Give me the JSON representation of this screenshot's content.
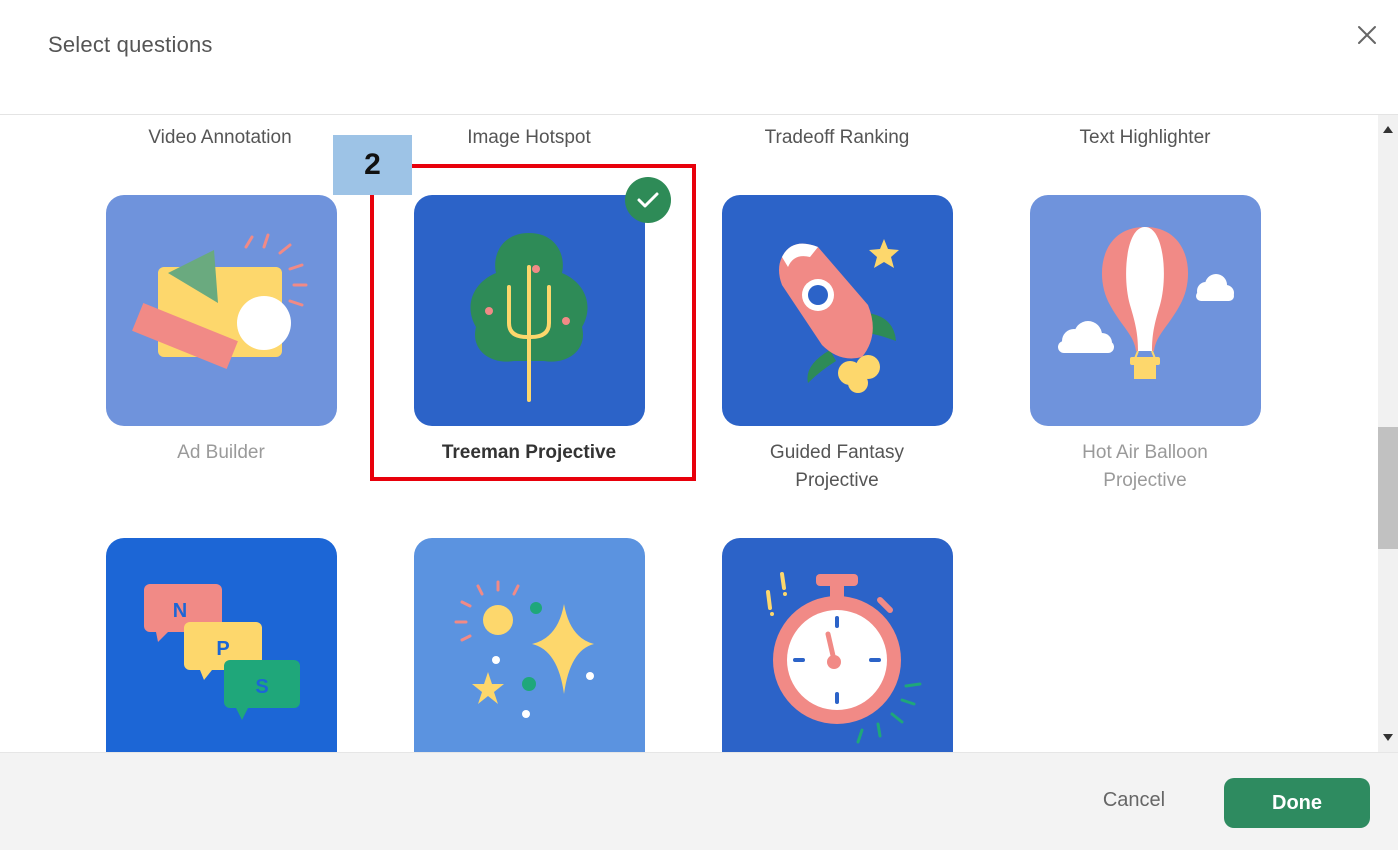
{
  "dialog": {
    "title": "Select questions",
    "close_icon": "close-icon"
  },
  "top_labels": [
    "Video Annotation",
    "Image Hotspot",
    "Tradeoff Ranking",
    "Text Highlighter"
  ],
  "tiles": [
    {
      "label": "Ad Builder",
      "icon": "ad-builder-icon",
      "selected": false,
      "bg": "#6f93dc"
    },
    {
      "label": "Treeman Projective",
      "icon": "tree-icon",
      "selected": true,
      "bg": "#2c63c8"
    },
    {
      "label": "Guided Fantasy Projective",
      "icon": "rocket-icon",
      "selected": false,
      "bg": "#2c63c8"
    },
    {
      "label": "Hot Air Balloon Projective",
      "icon": "hot-air-balloon-icon",
      "selected": false,
      "bg": "#6f93dc"
    },
    {
      "label": "",
      "icon": "nps-speech-bubbles-icon",
      "selected": false,
      "bg": "#1c66d6"
    },
    {
      "label": "",
      "icon": "sparkles-icon",
      "selected": false,
      "bg": "#5b93e0"
    },
    {
      "label": "",
      "icon": "stopwatch-icon",
      "selected": false,
      "bg": "#2c63c8"
    }
  ],
  "nps_letters": [
    "N",
    "P",
    "S"
  ],
  "selected_check_icon": "check-icon",
  "annotation": {
    "step": "2"
  },
  "footer": {
    "cancel_label": "Cancel",
    "done_label": "Done"
  },
  "colors": {
    "accent_green": "#2e8b60",
    "annotation_red": "#e8000b",
    "annotation_badge": "#9dc3e6"
  }
}
